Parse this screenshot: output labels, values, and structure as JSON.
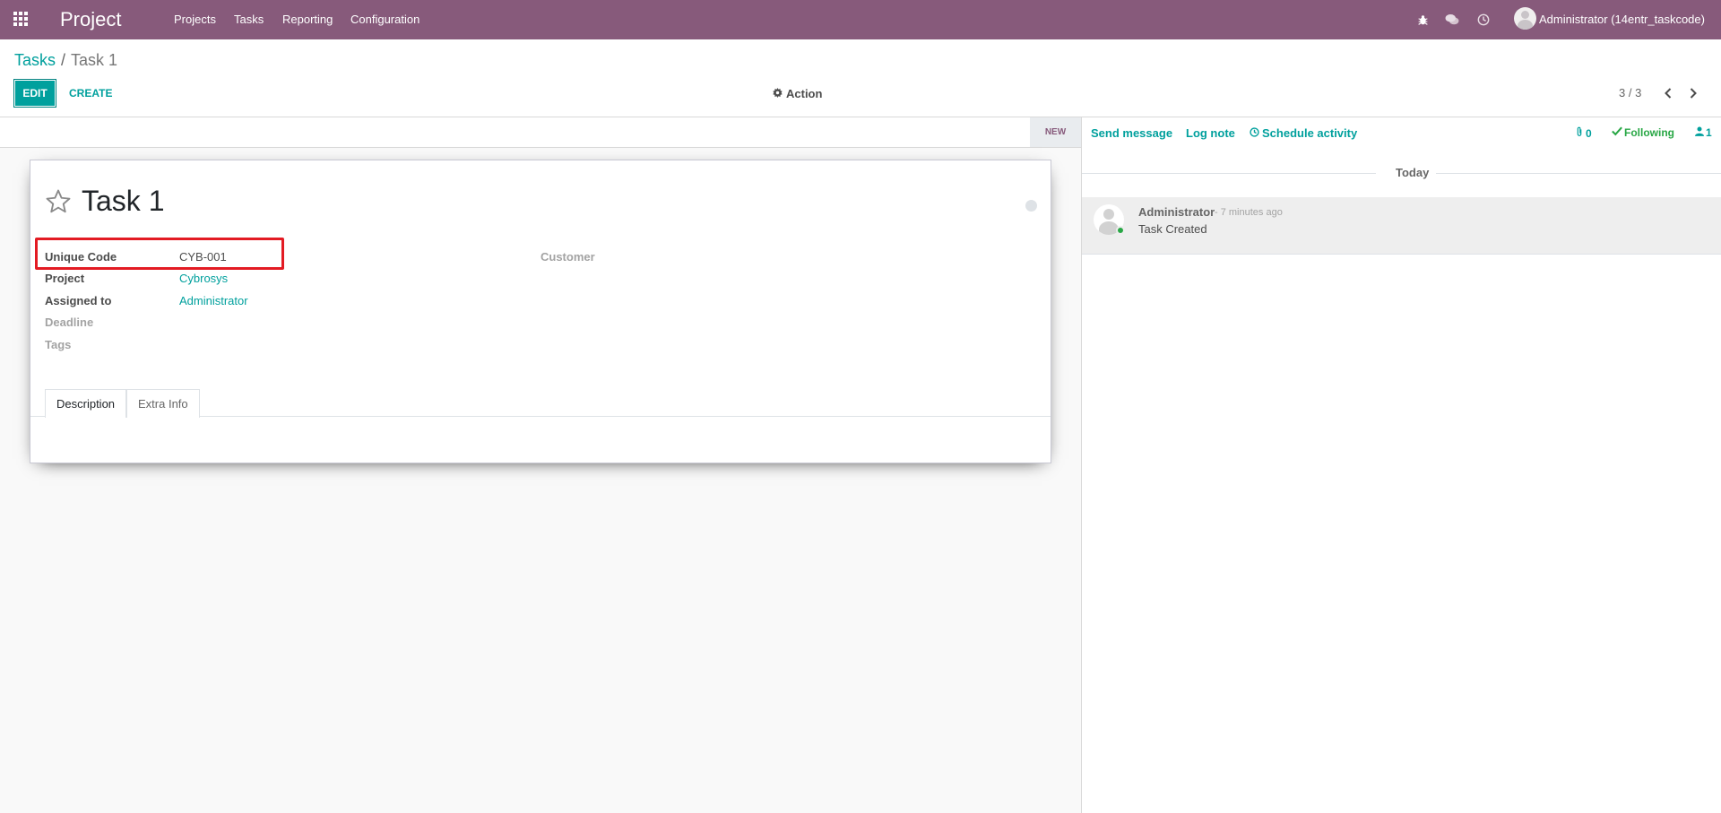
{
  "colors": {
    "navbar": "#875a7b",
    "accent": "#00a09d",
    "highlight": "#e31b23",
    "following": "#28a745"
  },
  "navbar": {
    "brand": "Project",
    "menu": [
      "Projects",
      "Tasks",
      "Reporting",
      "Configuration"
    ],
    "icons": [
      "bug-icon",
      "chat-icon",
      "clock-icon"
    ],
    "user": "Administrator (14entr_taskcode)"
  },
  "breadcrumb": {
    "parent": "Tasks",
    "separator": "/",
    "current": "Task 1"
  },
  "toolbar": {
    "edit": "EDIT",
    "create": "CREATE",
    "action": "Action"
  },
  "pager": {
    "value": "3 / 3"
  },
  "statusbar": {
    "stage": "NEW"
  },
  "form": {
    "title": "Task 1",
    "fields": {
      "unique_code_label": "Unique Code",
      "unique_code_value": "CYB-001",
      "project_label": "Project",
      "project_value": "Cybrosys",
      "assigned_label": "Assigned to",
      "assigned_value": "Administrator",
      "deadline_label": "Deadline",
      "tags_label": "Tags",
      "customer_label": "Customer"
    },
    "tabs": [
      "Description",
      "Extra Info"
    ]
  },
  "chatter": {
    "send_message": "Send message",
    "log_note": "Log note",
    "schedule_activity": "Schedule activity",
    "attachments": "0",
    "following": "Following",
    "followers": "1",
    "today": "Today",
    "message": {
      "author": "Administrator",
      "time": "- 7 minutes ago",
      "body": "Task Created"
    }
  }
}
